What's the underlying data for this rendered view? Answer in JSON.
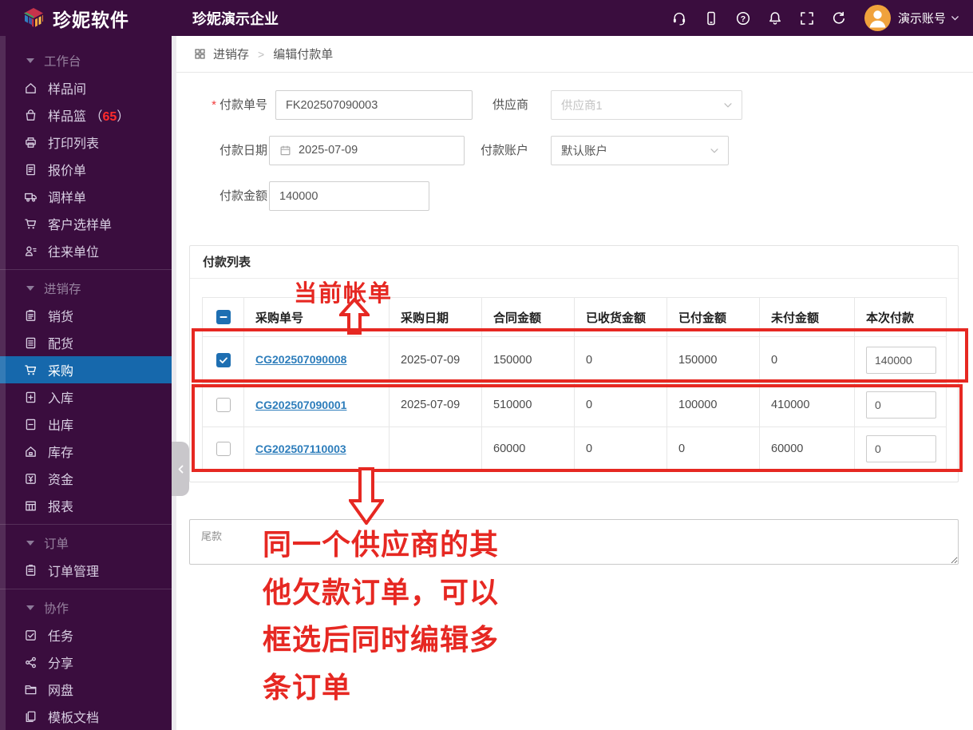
{
  "colors": {
    "header_bg": "#3a0d3e",
    "sidebar_bg": "#3a0d3e",
    "active_item_bg": "#1668ac",
    "checkbox_blue": "#1e6fb2",
    "link_blue": "#2d7dbb",
    "annotation_red": "#e62822",
    "badge_red": "#ff2b2b",
    "avatar_orange": "#f0a23c"
  },
  "header": {
    "logo_text": "珍妮软件",
    "company": "珍妮演示企业",
    "actions": [
      "headset-icon",
      "mobile-icon",
      "help-icon",
      "bell-icon",
      "fullscreen-icon",
      "refresh-icon"
    ],
    "account": "演示账号"
  },
  "sidebar": {
    "groups": [
      {
        "label": "工作台",
        "items": [
          {
            "icon": "home-icon",
            "label": "样品间"
          },
          {
            "icon": "basket-icon",
            "label": "样品篮",
            "badge_open": "（",
            "badge": "65",
            "badge_close": "）"
          },
          {
            "icon": "printer-icon",
            "label": "打印列表"
          },
          {
            "icon": "quote-doc-icon",
            "label": "报价单"
          },
          {
            "icon": "truck-icon",
            "label": "调样单"
          },
          {
            "icon": "cart-icon",
            "label": "客户选样单"
          },
          {
            "icon": "contacts-icon",
            "label": "往来单位"
          }
        ]
      },
      {
        "label": "进销存",
        "items": [
          {
            "icon": "sales-doc-icon",
            "label": "销货"
          },
          {
            "icon": "dispatch-doc-icon",
            "label": "配货"
          },
          {
            "icon": "purchase-cart-icon",
            "label": "采购",
            "active": true
          },
          {
            "icon": "file-plus-icon",
            "label": "入库"
          },
          {
            "icon": "file-minus-icon",
            "label": "出库"
          },
          {
            "icon": "warehouse-icon",
            "label": "库存"
          },
          {
            "icon": "yuan-icon",
            "label": "资金"
          },
          {
            "icon": "report-table-icon",
            "label": "报表"
          }
        ]
      },
      {
        "label": "订单",
        "items": [
          {
            "icon": "order-doc-icon",
            "label": "订单管理"
          }
        ]
      },
      {
        "label": "协作",
        "items": [
          {
            "icon": "task-check-icon",
            "label": "任务"
          },
          {
            "icon": "share-icon",
            "label": "分享"
          },
          {
            "icon": "folder-icon",
            "label": "网盘"
          },
          {
            "icon": "template-doc-icon",
            "label": "模板文档"
          }
        ]
      }
    ]
  },
  "breadcrumb": {
    "items": [
      "进销存",
      "编辑付款单"
    ],
    "separator": ">"
  },
  "form": {
    "required_mark": "*",
    "payment_no": {
      "label": "付款单号",
      "value": "FK202507090003"
    },
    "supplier": {
      "label": "供应商",
      "value": "供应商1"
    },
    "payment_date": {
      "label": "付款日期",
      "value": "2025-07-09"
    },
    "payment_account": {
      "label": "付款账户",
      "value": "默认账户"
    },
    "payment_amount": {
      "label": "付款金额",
      "value": "140000"
    }
  },
  "table": {
    "title": "付款列表",
    "columns": [
      "采购单号",
      "采购日期",
      "合同金额",
      "已收货金额",
      "已付金额",
      "未付金额",
      "本次付款"
    ],
    "rows": [
      {
        "checked": true,
        "po_no": "CG202507090008",
        "date": "2025-07-09",
        "contract": "150000",
        "received": "0",
        "paid": "150000",
        "unpaid": "0",
        "current": "140000"
      },
      {
        "checked": false,
        "po_no": "CG202507090001",
        "date": "2025-07-09",
        "contract": "510000",
        "received": "0",
        "paid": "100000",
        "unpaid": "410000",
        "current": "0"
      },
      {
        "checked": false,
        "po_no": "CG202507110003",
        "date": "",
        "contract": "60000",
        "received": "0",
        "paid": "0",
        "unpaid": "60000",
        "current": "0"
      }
    ]
  },
  "footer_field": {
    "placeholder": "尾款"
  },
  "annotations": {
    "current_bill_label": "当前帐单",
    "note_lines": [
      "同一个供应商的其",
      "他欠款订单，可以",
      "框选后同时编辑多",
      "条订单"
    ]
  }
}
